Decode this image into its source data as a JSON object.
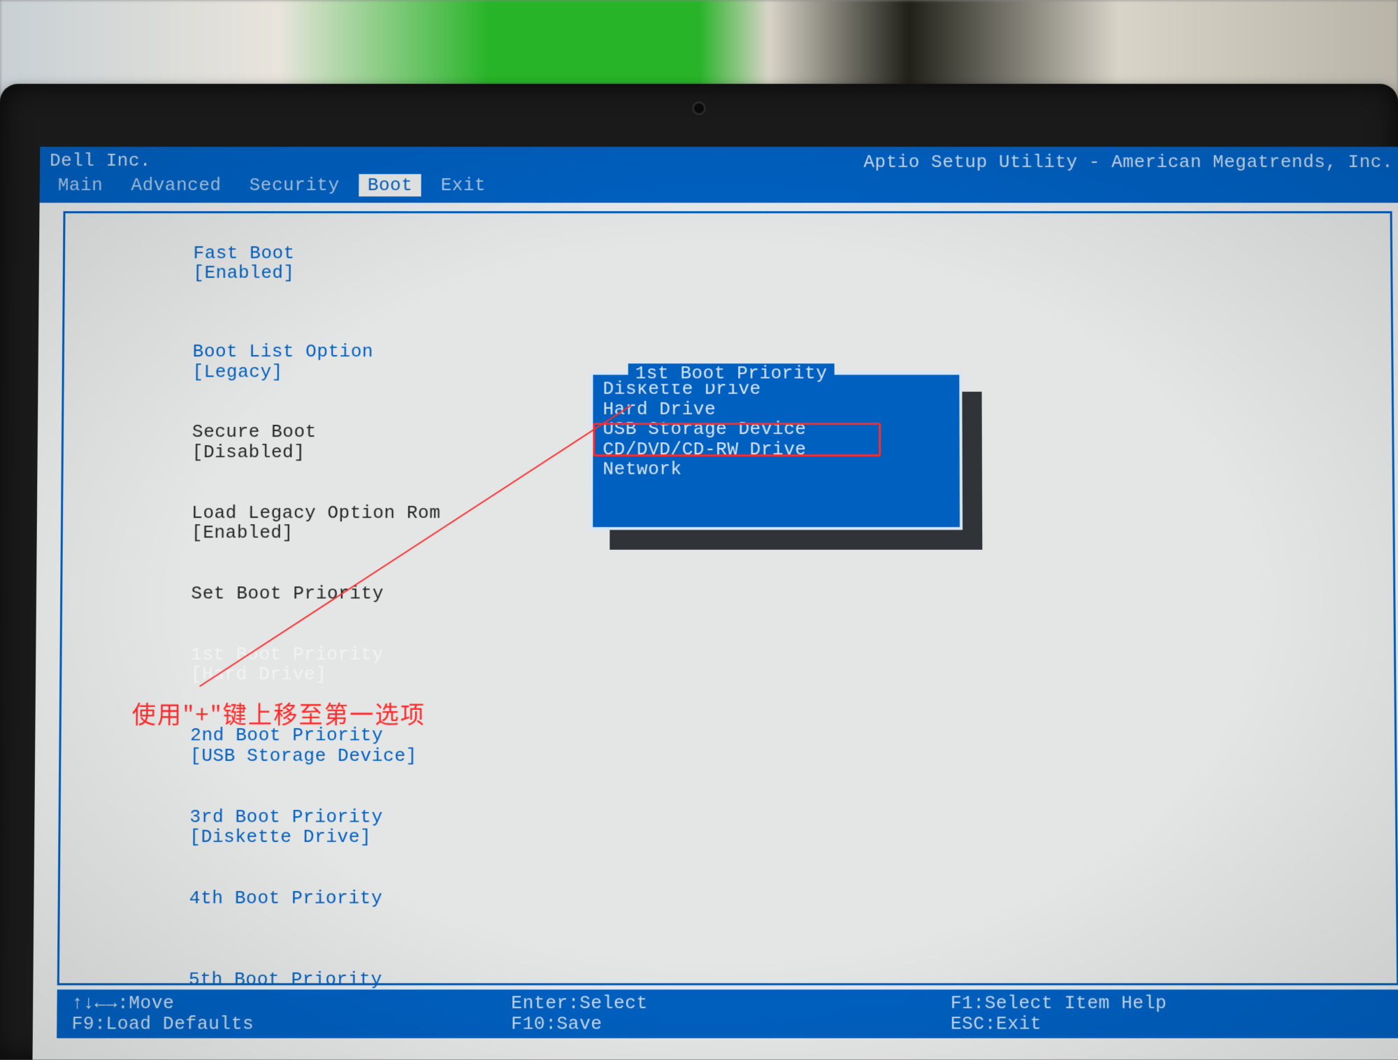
{
  "vendor": "Dell Inc.",
  "utility_title": "Aptio Setup Utility - American Megatrends, Inc.",
  "tabs": [
    "Main",
    "Advanced",
    "Security",
    "Boot",
    "Exit"
  ],
  "active_tab_index": 3,
  "settings": {
    "fast_boot": {
      "label": "Fast Boot",
      "value": "[Enabled]",
      "lbl_color": "blue",
      "val_color": "blue"
    },
    "boot_list_option": {
      "label": "Boot List Option",
      "value": "[Legacy]",
      "lbl_color": "blue",
      "val_color": "blue"
    },
    "secure_boot": {
      "label": "Secure Boot",
      "value": "[Disabled]",
      "lbl_color": "black",
      "val_color": "black"
    },
    "load_legacy_rom": {
      "label": "Load Legacy Option Rom",
      "value": "[Enabled]",
      "lbl_color": "black",
      "val_color": "black"
    },
    "set_boot_header": {
      "label": "Set Boot Priority",
      "value": "",
      "lbl_color": "black",
      "val_color": ""
    },
    "p1": {
      "label": "1st Boot Priority",
      "value": "[Hard Drive]",
      "lbl_color": "white",
      "val_color": "white"
    },
    "p2": {
      "label": "2nd Boot Priority",
      "value": "[USB Storage Device]",
      "lbl_color": "blue",
      "val_color": "blue"
    },
    "p3": {
      "label": "3rd Boot Priority",
      "value": "[Diskette Drive]",
      "lbl_color": "blue",
      "val_color": "blue"
    },
    "p4": {
      "label": "4th Boot Priority",
      "value": "",
      "lbl_color": "blue",
      "val_color": "blue"
    },
    "p5": {
      "label": "5th Boot Priority",
      "value": "",
      "lbl_color": "blue",
      "val_color": "blue"
    }
  },
  "popup": {
    "title": "1st Boot Priority",
    "items": [
      "Diskette Drive",
      "Hard Drive",
      "USB Storage Device",
      "CD/DVD/CD-RW Drive",
      "Network"
    ],
    "highlight_index": 2
  },
  "help": {
    "move": "↑↓←→:Move",
    "select": "Enter:Select",
    "itemhelp": "F1:Select Item Help",
    "defaults": "F9:Load Defaults",
    "save": "F10:Save",
    "exit": "ESC:Exit"
  },
  "annotation": {
    "text": "使用\"+\"键上移至第一选项"
  }
}
